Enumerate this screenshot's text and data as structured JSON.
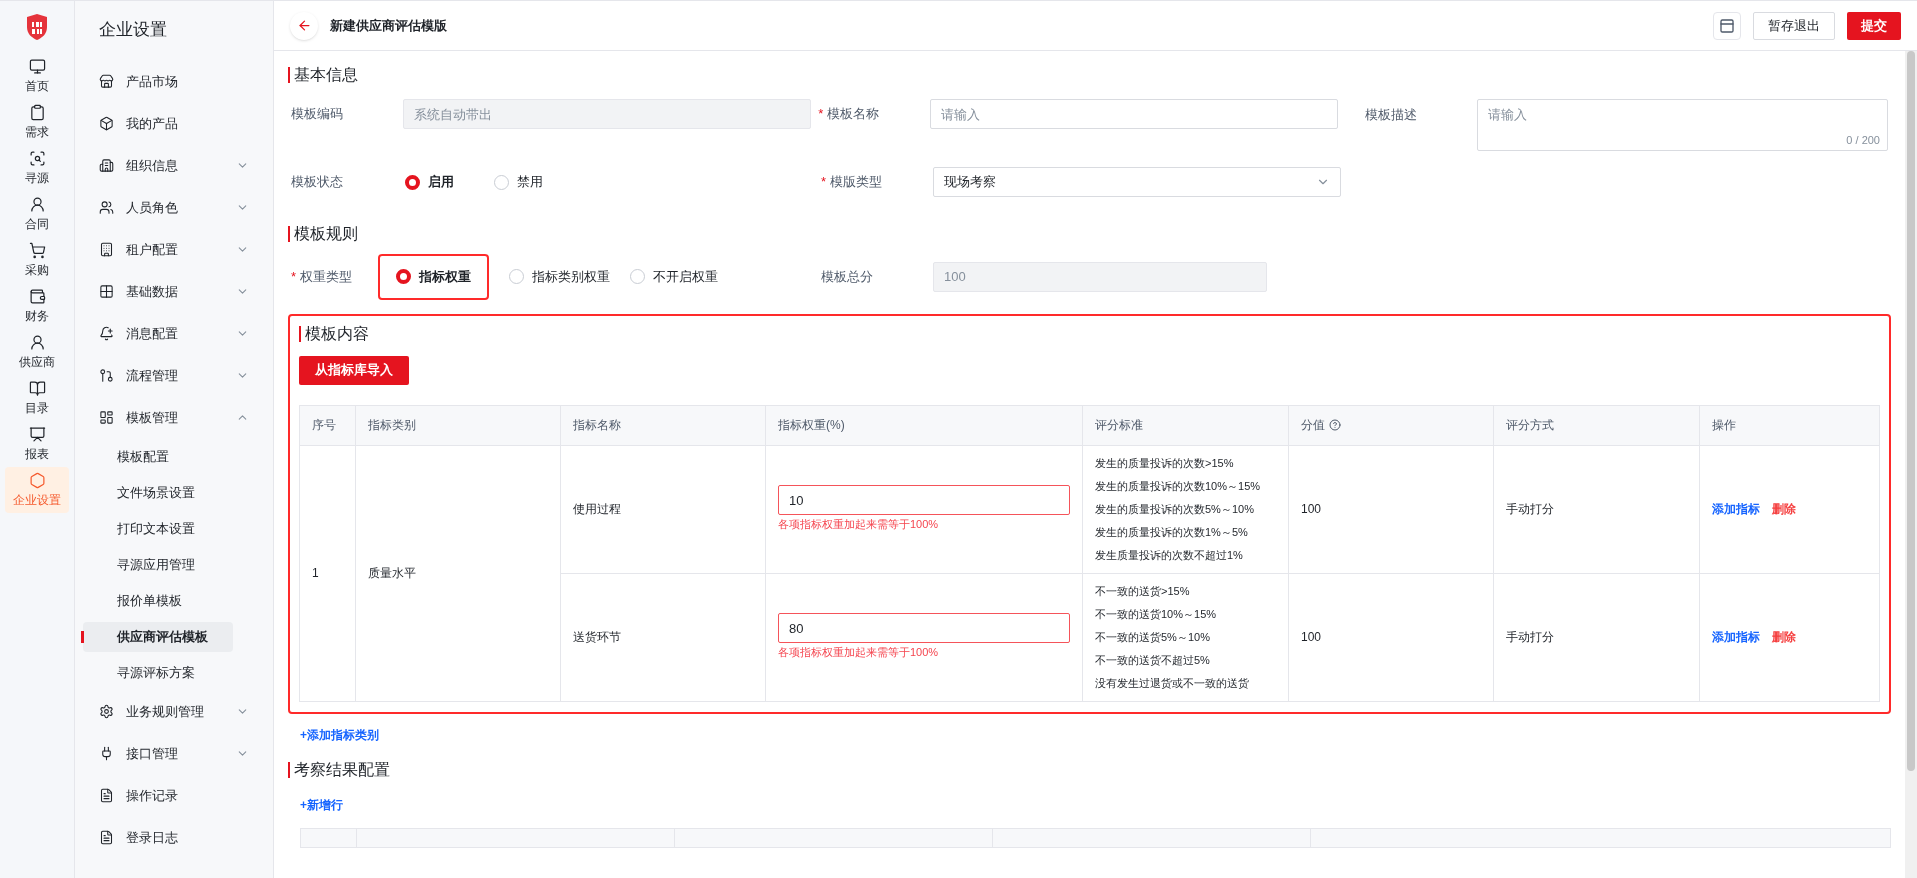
{
  "rail": {
    "items": [
      {
        "label": "首页",
        "selected": false
      },
      {
        "label": "需求",
        "selected": false
      },
      {
        "label": "寻源",
        "selected": false
      },
      {
        "label": "合同",
        "selected": false
      },
      {
        "label": "采购",
        "selected": false
      },
      {
        "label": "财务",
        "selected": false
      },
      {
        "label": "供应商",
        "selected": false
      },
      {
        "label": "目录",
        "selected": false
      },
      {
        "label": "报表",
        "selected": false
      },
      {
        "label": "企业设置",
        "selected": true
      }
    ]
  },
  "required_mark": "*",
  "sidebar": {
    "title": "企业设置",
    "items": [
      {
        "label": "产品市场",
        "kind": "link"
      },
      {
        "label": "我的产品",
        "kind": "link"
      },
      {
        "label": "组织信息",
        "kind": "group",
        "expanded": false
      },
      {
        "label": "人员角色",
        "kind": "group",
        "expanded": false
      },
      {
        "label": "租户配置",
        "kind": "group",
        "expanded": false
      },
      {
        "label": "基础数据",
        "kind": "group",
        "expanded": false
      },
      {
        "label": "消息配置",
        "kind": "group",
        "expanded": false
      },
      {
        "label": "流程管理",
        "kind": "group",
        "expanded": false
      },
      {
        "label": "模板管理",
        "kind": "group",
        "expanded": true,
        "children": [
          {
            "label": "模板配置",
            "selected": false
          },
          {
            "label": "文件场景设置",
            "selected": false
          },
          {
            "label": "打印文本设置",
            "selected": false
          },
          {
            "label": "寻源应用管理",
            "selected": false
          },
          {
            "label": "报价单模板",
            "selected": false
          },
          {
            "label": "供应商评估模板",
            "selected": true
          },
          {
            "label": "寻源评标方案",
            "selected": false
          }
        ]
      },
      {
        "label": "业务规则管理",
        "kind": "group",
        "expanded": false
      },
      {
        "label": "接口管理",
        "kind": "group",
        "expanded": false
      },
      {
        "label": "操作记录",
        "kind": "link"
      },
      {
        "label": "登录日志",
        "kind": "link"
      }
    ]
  },
  "header": {
    "title": "新建供应商评估模版",
    "buttons": [
      {
        "label": "暂存退出",
        "primary": false
      },
      {
        "label": "提交",
        "primary": true
      }
    ]
  },
  "basic_info": {
    "title": "基本信息",
    "code": {
      "label": "模板编码",
      "placeholder": "系统自动带出"
    },
    "name": {
      "label": "模板名称",
      "placeholder": "请输入",
      "required": true
    },
    "description": {
      "label": "模板描述",
      "placeholder": "请输入",
      "counter": "0 / 200"
    },
    "status": {
      "label": "模板状态",
      "options": [
        {
          "label": "启用",
          "selected": true
        },
        {
          "label": "禁用",
          "selected": false
        }
      ]
    },
    "type": {
      "label": "模版类型",
      "value": "现场考察",
      "required": true
    }
  },
  "rules": {
    "title": "模板规则",
    "weight_type": {
      "label": "权重类型",
      "required": true,
      "highlighted": true,
      "options": [
        {
          "label": "指标权重",
          "selected": true
        },
        {
          "label": "指标类别权重",
          "selected": false
        },
        {
          "label": "不开启权重",
          "selected": false
        }
      ]
    },
    "total": {
      "label": "模板总分",
      "value": "100"
    }
  },
  "content": {
    "title": "模板内容",
    "highlighted": true,
    "import_button": "从指标库导入",
    "table": {
      "columns": [
        "序号",
        "指标类别",
        "指标名称",
        "指标权重(%)",
        "评分标准",
        "分值",
        "评分方式",
        "操作"
      ],
      "groups": [
        {
          "index": "1",
          "category": "质量水平",
          "rows": [
            {
              "name": "使用过程",
              "weight": "10",
              "error": "各项指标权重加起来需等于100%",
              "criteria": [
                "发生的质量投诉的次数>15%",
                "发生的质量投诉的次数10%～15%",
                "发生的质量投诉的次数5%～10%",
                "发生的质量投诉的次数1%～5%",
                "发生质量投诉的次数不超过1%"
              ],
              "score": "100",
              "method": "手动打分",
              "actions": [
                {
                  "label": "添加指标",
                  "kind": "link"
                },
                {
                  "label": "删除",
                  "kind": "danger"
                }
              ]
            },
            {
              "name": "送货环节",
              "weight": "80",
              "error": "各项指标权重加起来需等于100%",
              "criteria": [
                "不一致的送货>15%",
                "不一致的送货10%～15%",
                "不一致的送货5%～10%",
                "不一致的送货不超过5%",
                "没有发生过退货或不一致的送货"
              ],
              "score": "100",
              "method": "手动打分",
              "actions": [
                {
                  "label": "添加指标",
                  "kind": "link"
                },
                {
                  "label": "删除",
                  "kind": "danger"
                }
              ]
            }
          ]
        }
      ]
    }
  },
  "add_category": "+添加指标类别",
  "result_config": {
    "title": "考察结果配置",
    "add_row": "+新增行"
  }
}
